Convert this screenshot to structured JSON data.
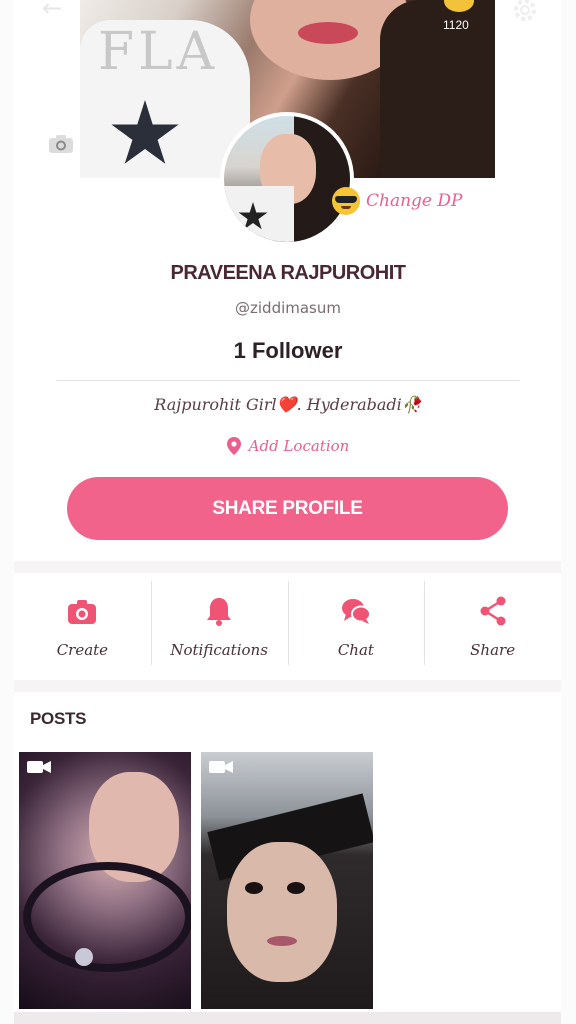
{
  "header": {
    "coin_count": "1120"
  },
  "profile": {
    "name": "PRAVEENA RAJPUROHIT",
    "handle": "@ziddimasum",
    "followers": "1 Follower",
    "bio": "Rajpurohit Girl❤️. Hyderabadi🥀",
    "location_label": "Add Location",
    "change_dp_label": "Change DP",
    "share_button_label": "SHARE PROFILE"
  },
  "actions": [
    {
      "label": "Create",
      "icon": "camera-icon"
    },
    {
      "label": "Notifications",
      "icon": "bell-icon"
    },
    {
      "label": "Chat",
      "icon": "chat-bubbles-icon"
    },
    {
      "label": "Share",
      "icon": "share-icon"
    }
  ],
  "posts": {
    "title": "POSTS",
    "items": [
      {
        "type": "video"
      },
      {
        "type": "video"
      }
    ]
  },
  "colors": {
    "accent": "#f2638c",
    "accent_text": "#ea5f8d",
    "coin": "#f2c23a"
  }
}
